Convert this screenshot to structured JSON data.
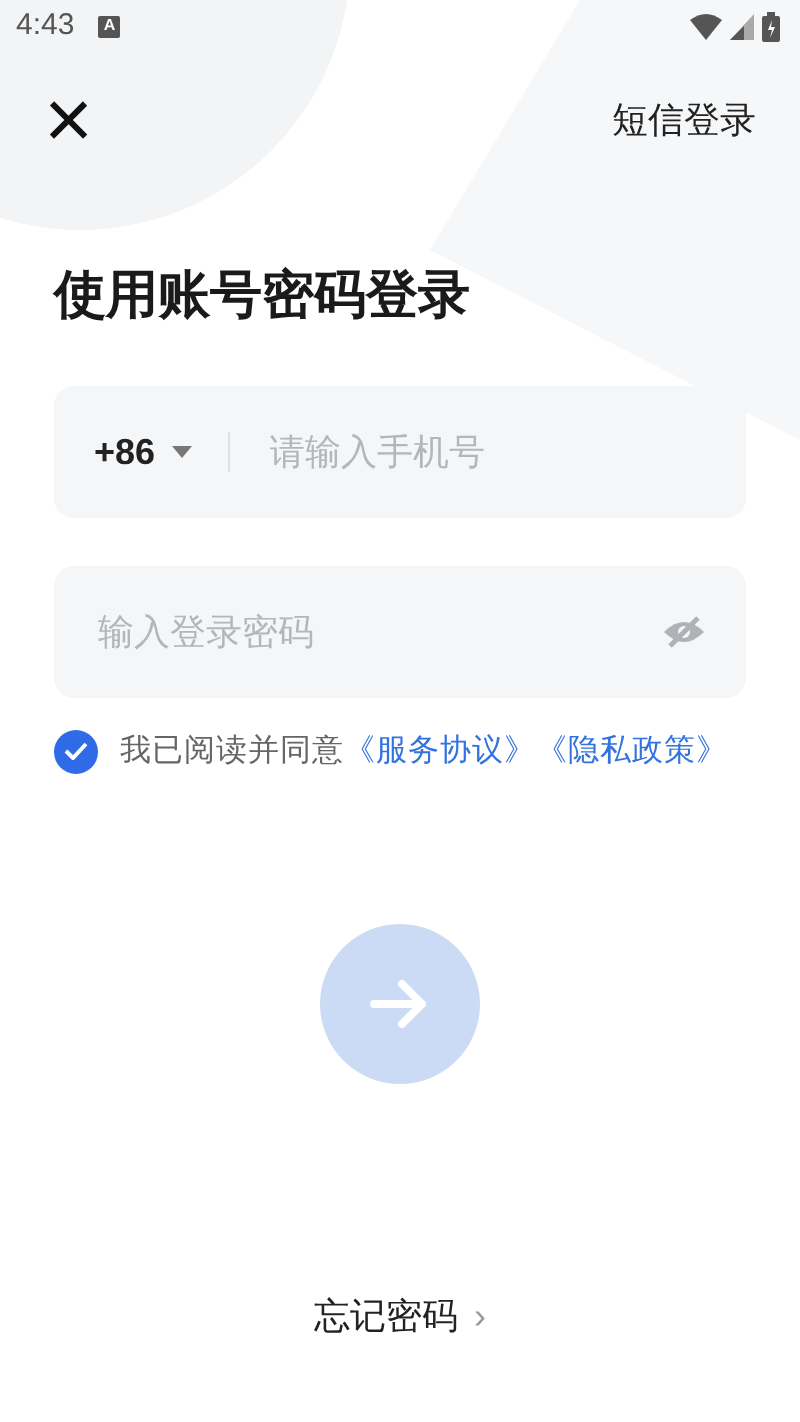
{
  "status_bar": {
    "time": "4:43",
    "notification_badge": "A"
  },
  "top_bar": {
    "close": "×",
    "sms_login": "短信登录"
  },
  "title": "使用账号密码登录",
  "phone_field": {
    "country_code": "+86",
    "placeholder": "请输入手机号"
  },
  "password_field": {
    "placeholder": "输入登录密码",
    "visible": false
  },
  "agreement": {
    "checked": true,
    "text": "我已阅读并同意",
    "links": [
      "《服务协议》",
      "《隐私政策》"
    ]
  },
  "submit": {
    "disabled": true
  },
  "forgot_password": {
    "label": "忘记密码",
    "chevron": "›"
  }
}
